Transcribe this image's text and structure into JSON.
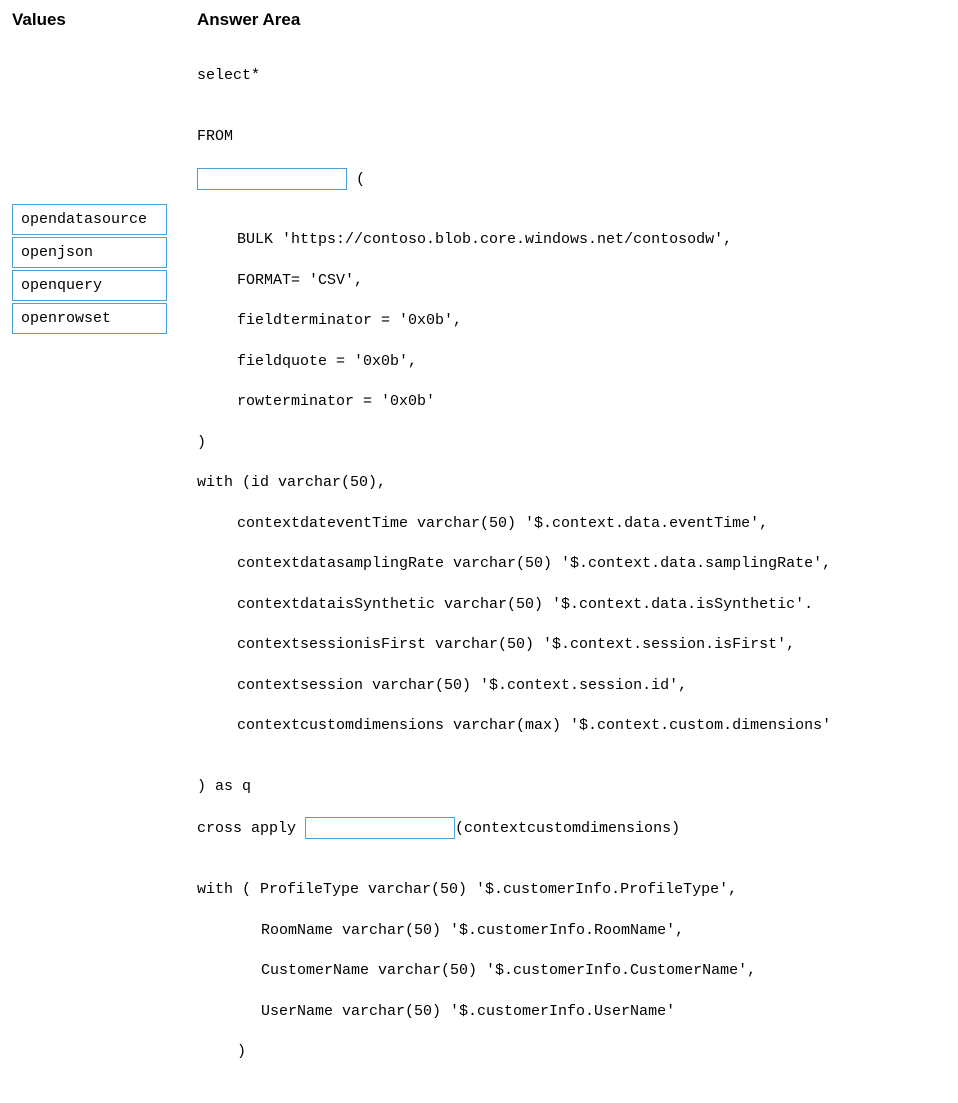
{
  "headings": {
    "values": "Values",
    "answer_area": "Answer Area"
  },
  "values_list": {
    "item0": "opendatasource",
    "item1": "openjson",
    "item2": "openquery",
    "item3": "openrowset"
  },
  "code": {
    "l1": "select*",
    "l2": "",
    "l3": "FROM",
    "l4_after": " (",
    "l5": "",
    "l6": "BULK 'https://contoso.blob.core.windows.net/contosodw',",
    "l7": "FORMAT= 'CSV',",
    "l8": "fieldterminator = '0x0b',",
    "l9": "fieldquote = '0x0b',",
    "l10": "rowterminator = '0x0b'",
    "l11": ")",
    "l12": "with (id varchar(50),",
    "l13": "contextdateventTime varchar(50) '$.context.data.eventTime',",
    "l14": "contextdatasamplingRate varchar(50) '$.context.data.samplingRate',",
    "l15": "contextdataisSynthetic varchar(50) '$.context.data.isSynthetic'.",
    "l16": "contextsessionisFirst varchar(50) '$.context.session.isFirst',",
    "l17": "contextsession varchar(50) '$.context.session.id',",
    "l18": "contextcustomdimensions varchar(max) '$.context.custom.dimensions'",
    "l19": "",
    "l20": ") as q",
    "l21_before": "cross apply ",
    "l21_after": "(contextcustomdimensions)",
    "l22": "",
    "l23": "with ( ProfileType varchar(50) '$.customerInfo.ProfileType',",
    "l24": "RoomName varchar(50) '$.customerInfo.RoomName',",
    "l25": "CustomerName varchar(50) '$.customerInfo.CustomerName',",
    "l26": "UserName varchar(50) '$.customerInfo.UserName'",
    "l27": ")"
  }
}
